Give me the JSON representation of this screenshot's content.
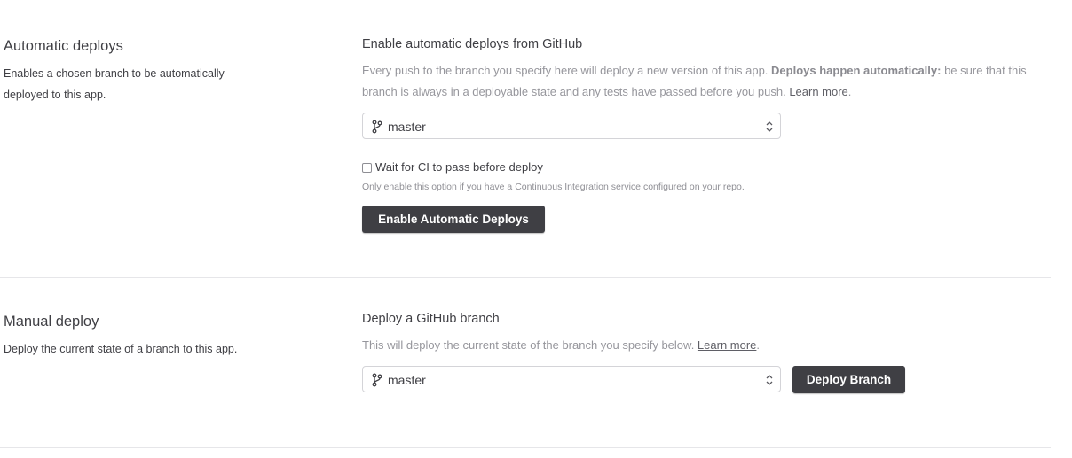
{
  "automatic": {
    "title": "Automatic deploys",
    "desc_line1": "Enables a chosen branch to be automatically",
    "desc_line2": "deployed to this app.",
    "heading": "Enable automatic deploys from GitHub",
    "text_part1": "Every push to the branch you specify here will deploy a new version of this app. ",
    "text_bold": "Deploys happen automatically:",
    "text_part2": " be sure that this",
    "text_line2": "branch is always in a deployable state and any tests have passed before you push. ",
    "learn_more": "Learn more",
    "period": ".",
    "branch": "master",
    "ci_checkbox_label": "Wait for CI to pass before deploy",
    "ci_checked": false,
    "ci_hint": "Only enable this option if you have a Continuous Integration service configured on your repo.",
    "button_label": "Enable Automatic Deploys"
  },
  "manual": {
    "title": "Manual deploy",
    "desc": "Deploy the current state of a branch to this app.",
    "heading": "Deploy a GitHub branch",
    "text": "This will deploy the current state of the branch you specify below. ",
    "learn_more": "Learn more",
    "period": ".",
    "branch": "master",
    "button_label": "Deploy Branch"
  },
  "icons": {
    "branch": "git-branch-icon",
    "select": "up-down-chevron-icon"
  },
  "colors": {
    "button_bg": "#3f3f44",
    "muted_text": "#96969c",
    "divider": "#e6e6e9"
  }
}
